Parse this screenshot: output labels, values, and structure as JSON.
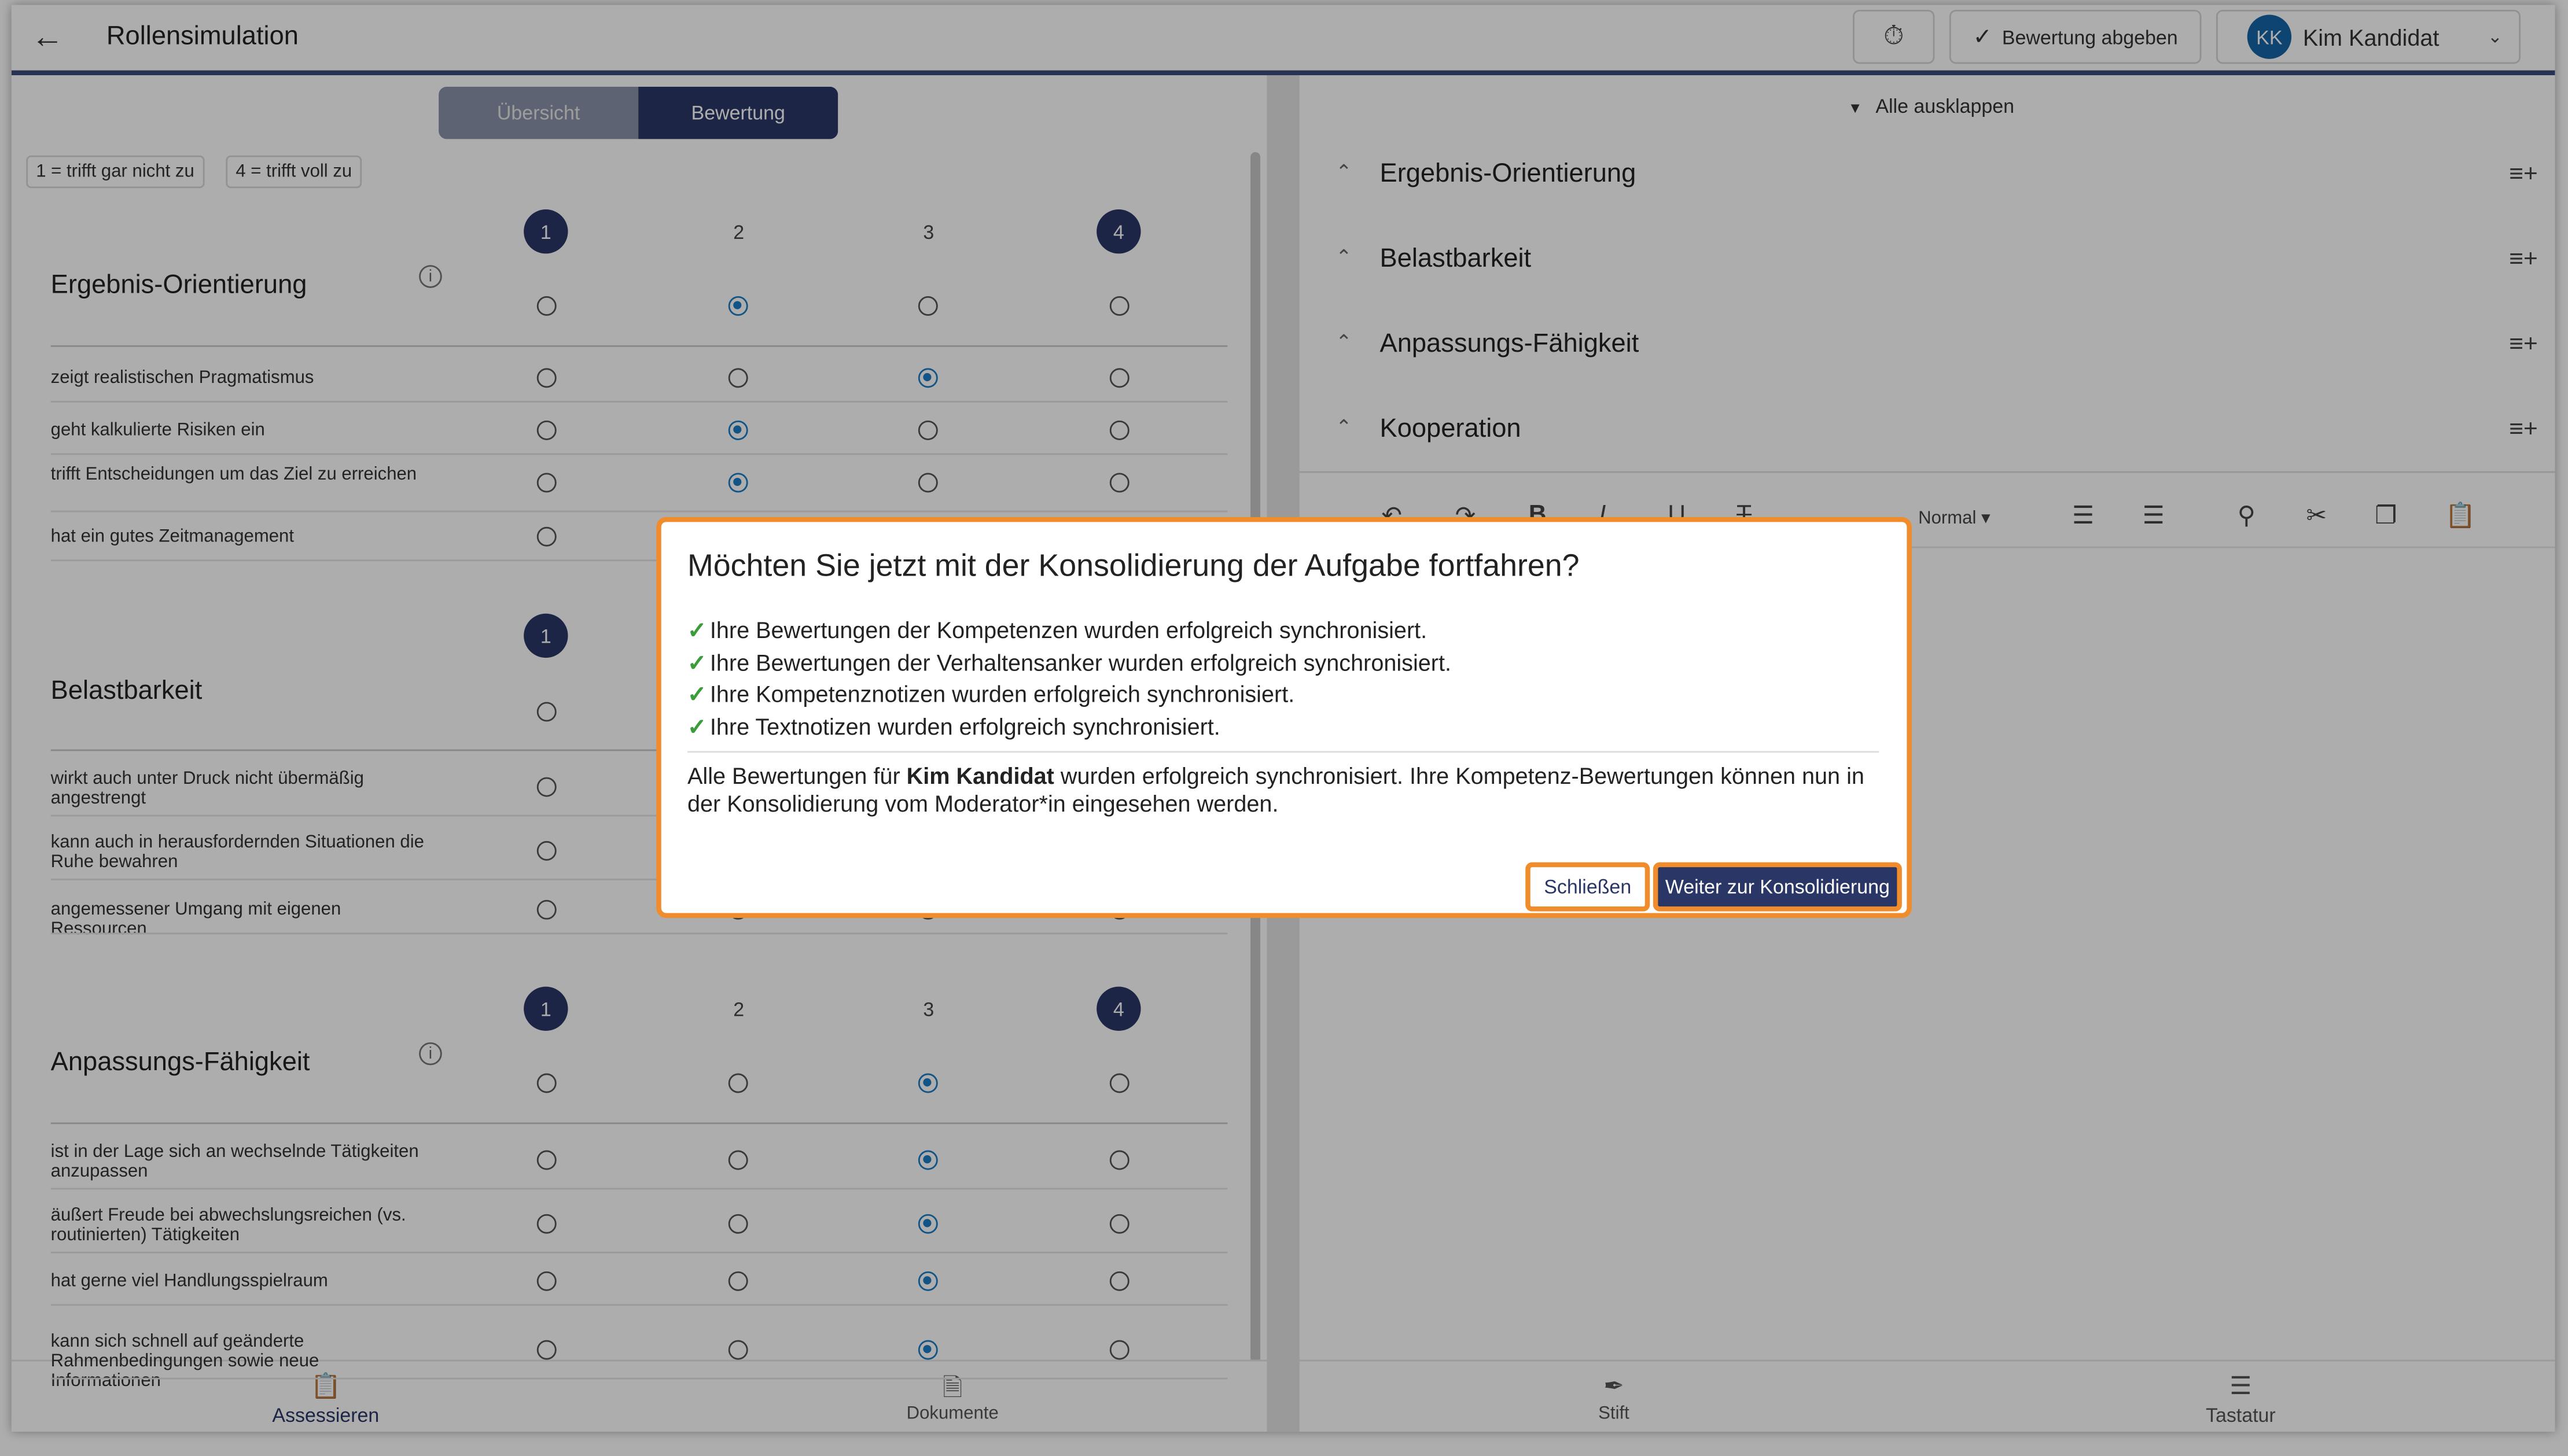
{
  "header": {
    "back_icon": "arrow-left-icon",
    "title": "Rollensimulation",
    "timer_icon": "stopwatch-icon",
    "submit_label": "Bewertung abgeben",
    "user_initials": "KK",
    "user_name": "Kim Kandidat"
  },
  "left": {
    "tabs": [
      "Übersicht",
      "Bewertung"
    ],
    "active_tab": "Bewertung",
    "legend_low": "1 = trifft gar nicht zu",
    "legend_high": "4 = trifft voll zu",
    "scale": [
      "1",
      "2",
      "3",
      "4"
    ],
    "competencies": [
      {
        "name": "Ergebnis-Orientierung",
        "rating": 2,
        "items": [
          {
            "text": "zeigt realistischen Pragmatismus",
            "rating": 3
          },
          {
            "text": "geht kalkulierte Risiken ein",
            "rating": 2
          },
          {
            "text": "trifft Entscheidungen um das Ziel zu erreichen",
            "rating": 2
          },
          {
            "text": "hat ein gutes Zeitmanagement",
            "rating": 0
          }
        ]
      },
      {
        "name": "Belastbarkeit",
        "rating": 0,
        "items": [
          {
            "text": "wirkt auch unter Druck nicht übermäßig angestrengt",
            "rating": 0
          },
          {
            "text": "kann auch in herausfordernden Situationen die Ruhe bewahren",
            "rating": 0
          },
          {
            "text": "angemessener Umgang mit eigenen Ressourcen",
            "rating": 0
          }
        ]
      },
      {
        "name": "Anpassungs-Fähigkeit",
        "rating": 3,
        "items": [
          {
            "text": "ist in der Lage sich an wechselnde Tätigkeiten anzupassen",
            "rating": 3
          },
          {
            "text": "äußert Freude bei abwechslungsreichen (vs. routinierten) Tätigkeiten",
            "rating": 3
          },
          {
            "text": "hat gerne viel Handlungsspielraum",
            "rating": 3
          },
          {
            "text": "kann sich schnell auf geänderte Rahmenbedingungen sowie neue Informationen",
            "rating": 3
          }
        ]
      }
    ]
  },
  "right": {
    "expand_all": "Alle ausklappen",
    "sections": [
      "Ergebnis-Orientierung",
      "Belastbarkeit",
      "Anpassungs-Fähigkeit",
      "Kooperation"
    ],
    "toolbar": {
      "undo_icon": "undo-icon",
      "redo_icon": "redo-icon",
      "bold": "B",
      "italic": "I",
      "underline": "U",
      "strike": "T",
      "format_style": "Normal",
      "search_icon": "search-icon",
      "cut_icon": "scissors-icon",
      "copy_icon": "copy-icon",
      "paste_icon": "clipboard-icon"
    }
  },
  "bottom_nav": {
    "assess": "Assessieren",
    "documents": "Dokumente",
    "pen": "Stift",
    "keyboard": "Tastatur"
  },
  "dialog": {
    "title": "Möchten Sie jetzt mit der Konsolidierung der Aufgabe fortfahren?",
    "checks": [
      "Ihre Bewertungen der Kompetenzen wurden erfolgreich synchronisiert.",
      "Ihre Bewertungen der Verhaltensanker wurden erfolgreich synchronisiert.",
      "Ihre Kompetenznotizen wurden erfolgreich synchronisiert.",
      "Ihre Textnotizen wurden erfolgreich synchronisiert."
    ],
    "message_prefix": "Alle Bewertungen für ",
    "message_name": "Kim Kandidat",
    "message_suffix": " wurden erfolgreich synchronisiert. Ihre Kompetenz-Bewertungen können nun in der Konsolidierung vom Moderator*in eingesehen werden.",
    "close_label": "Schließen",
    "continue_label": "Weiter zur Konsolidierung"
  },
  "colors": {
    "primary": "#2a3766",
    "radio_selected": "#1a7dc4",
    "highlight": "#f08c2c",
    "success": "#3a9d3a"
  }
}
